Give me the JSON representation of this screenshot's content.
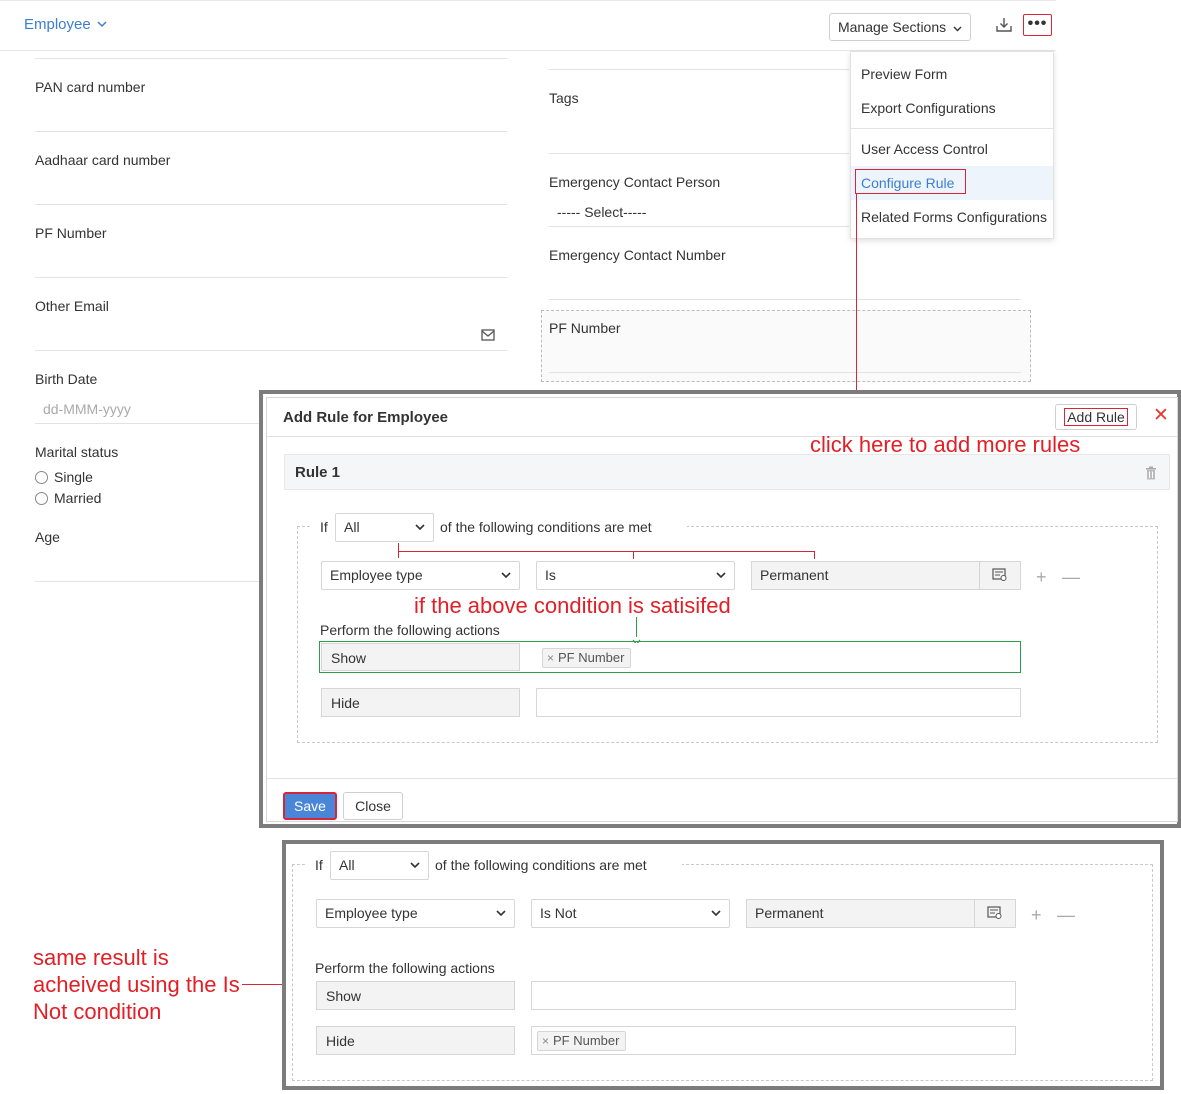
{
  "header": {
    "form_title": "Employee",
    "manage_sections": "Manage Sections"
  },
  "form": {
    "left_fields": [
      {
        "label": "PAN card number"
      },
      {
        "label": "Aadhaar card number"
      },
      {
        "label": "PF Number"
      },
      {
        "label": "Other Email"
      },
      {
        "label": "Birth Date",
        "placeholder": "dd-MMM-yyyy"
      },
      {
        "label": "Marital status",
        "options": [
          "Single",
          "Married"
        ]
      },
      {
        "label": "Age"
      }
    ],
    "right_fields": [
      {
        "label": "Tags"
      },
      {
        "label": "Emergency Contact Person",
        "value": "----- Select-----"
      },
      {
        "label": "Emergency Contact Number"
      },
      {
        "label": "PF Number"
      }
    ]
  },
  "menu": {
    "items": [
      "Preview Form",
      "Export Configurations",
      "User Access Control",
      "Configure Rule",
      "Related Forms Configurations"
    ]
  },
  "dialog": {
    "title": "Add Rule for Employee",
    "add_rule": "Add Rule",
    "close_symbol": "✕",
    "rule_title": "Rule 1",
    "condition": {
      "if": "If",
      "match": "All",
      "suffix": "of the following conditions are met",
      "field": "Employee type",
      "operator": "Is",
      "value": "Permanent"
    },
    "actions_label": "Perform the following actions",
    "actions": [
      {
        "label": "Show",
        "chips": [
          "PF Number"
        ]
      },
      {
        "label": "Hide",
        "chips": []
      }
    ],
    "save": "Save",
    "close": "Close"
  },
  "second_rule": {
    "condition": {
      "if": "If",
      "match": "All",
      "suffix": "of the following conditions are met",
      "field": "Employee type",
      "operator": "Is Not",
      "value": "Permanent"
    },
    "actions_label": "Perform the following actions",
    "actions": [
      {
        "label": "Show",
        "chips": []
      },
      {
        "label": "Hide",
        "chips": [
          "PF Number"
        ]
      }
    ]
  },
  "annotations": {
    "add_rules": "click here to add more rules",
    "condition_satisfied": "if the above condition is satisifed",
    "same_result": "same result is acheived using the Is Not condition"
  },
  "colors": {
    "accent": "#3b7fd1",
    "annotation_red": "#e21f26",
    "save_button": "#4a86d8",
    "show_border": "#2e9e4a"
  },
  "icons": {
    "download": "download-icon",
    "more": "more-icon",
    "email": "email-icon",
    "trash": "trash-icon",
    "lookup": "lookup-icon"
  },
  "glyphs": {
    "more": "•••",
    "plus": "+",
    "minus": "—",
    "chip_remove": "×"
  }
}
